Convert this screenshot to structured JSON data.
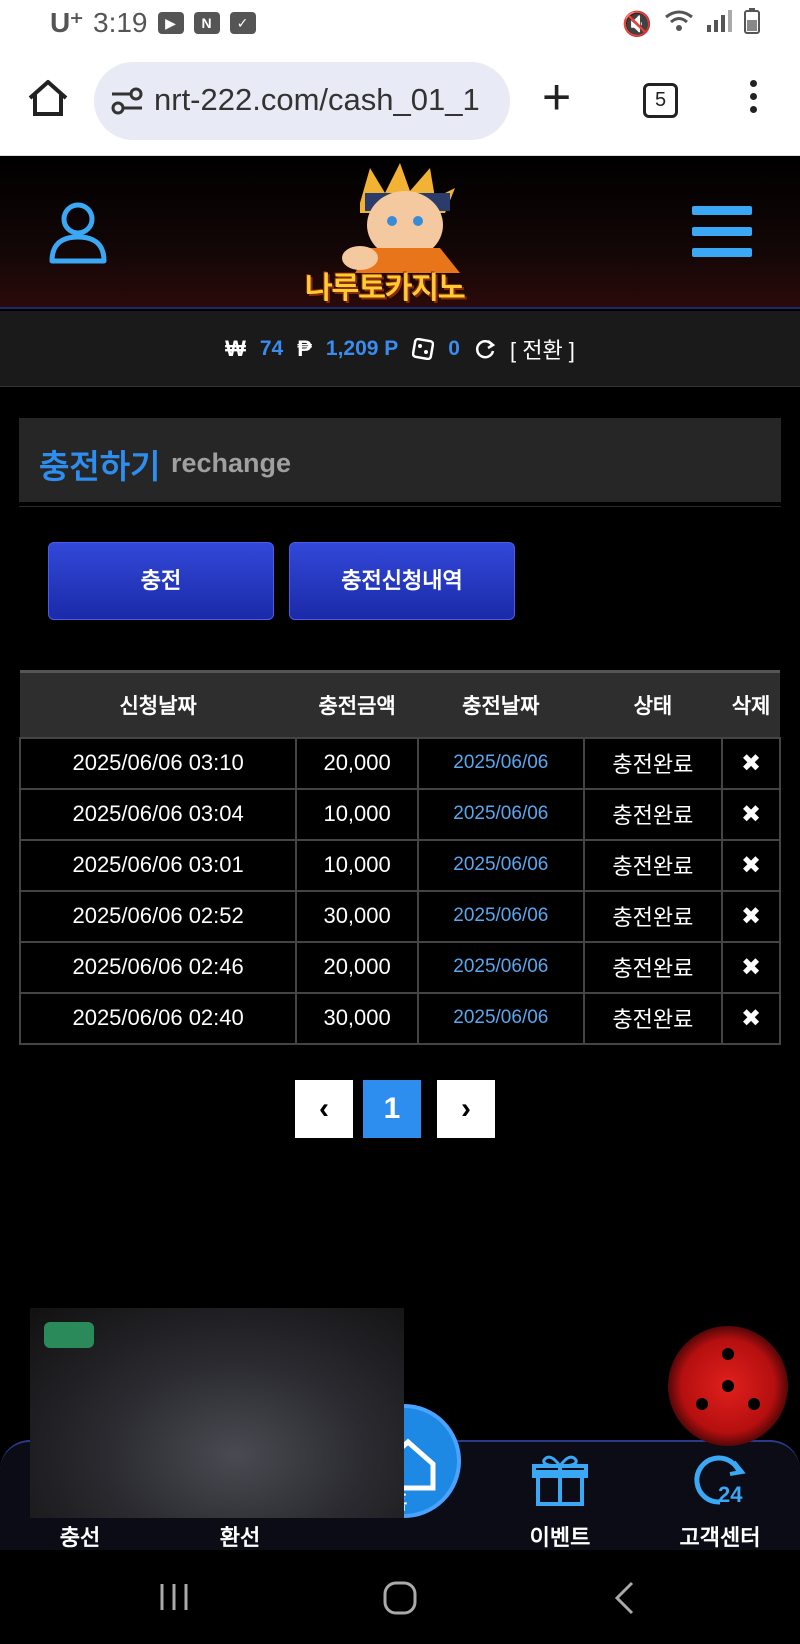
{
  "status": {
    "carrier": "U⁺",
    "time": "3:19"
  },
  "browser": {
    "url": "nrt-222.com/cash_01_1",
    "tab_count": "5"
  },
  "site": {
    "logo_text": "나루토카지노"
  },
  "balance": {
    "won_symbol": "₩",
    "won": "74",
    "point_symbol": "₱",
    "point": "1,209 P",
    "chip": "0",
    "switch_label": "[ 전환 ]"
  },
  "page": {
    "title_ko": "충전하기",
    "title_en": "rechange"
  },
  "buttons": {
    "charge": "충전",
    "history": "충전신청내역"
  },
  "table": {
    "headers": [
      "신청날짜",
      "충전금액",
      "충전날짜",
      "상태",
      "삭제"
    ],
    "rows": [
      {
        "req": "2025/06/06 03:10",
        "amount": "20,000",
        "date": "2025/06/06",
        "status": "충전완료",
        "del": "✖"
      },
      {
        "req": "2025/06/06 03:04",
        "amount": "10,000",
        "date": "2025/06/06",
        "status": "충전완료",
        "del": "✖"
      },
      {
        "req": "2025/06/06 03:01",
        "amount": "10,000",
        "date": "2025/06/06",
        "status": "충전완료",
        "del": "✖"
      },
      {
        "req": "2025/06/06 02:52",
        "amount": "30,000",
        "date": "2025/06/06",
        "status": "충전완료",
        "del": "✖"
      },
      {
        "req": "2025/06/06 02:46",
        "amount": "20,000",
        "date": "2025/06/06",
        "status": "충전완료",
        "del": "✖"
      },
      {
        "req": "2025/06/06 02:40",
        "amount": "30,000",
        "date": "2025/06/06",
        "status": "충전완료",
        "del": "✖"
      }
    ]
  },
  "pagination": {
    "prev": "‹",
    "current": "1",
    "next": "›"
  },
  "bottom_nav": {
    "deposit": "충선",
    "withdraw": "환선",
    "home": "홈",
    "event": "이벤트",
    "support": "고객센터"
  },
  "colors": {
    "accent": "#2d8ef0",
    "button": "#2a3ec8",
    "icon": "#3aa8f5"
  }
}
